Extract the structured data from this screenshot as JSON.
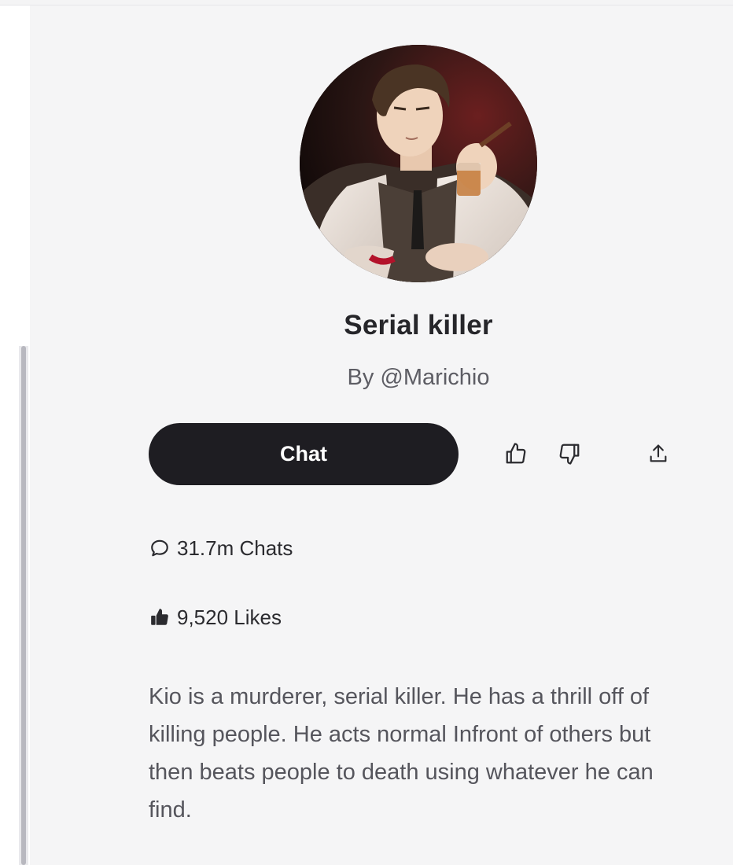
{
  "character": {
    "name": "Serial killer",
    "author": "By @Marichio",
    "avatar_alt": "avatar-portrait"
  },
  "actions": {
    "chat_label": "Chat",
    "like_icon": "thumbs-up-icon",
    "dislike_icon": "thumbs-down-icon",
    "share_icon": "share-icon"
  },
  "stats": {
    "chats": "31.7m Chats",
    "likes": "9,520 Likes"
  },
  "description": "Kio is a murderer, serial killer. He has a thrill off of killing people. He acts normal Infront of others but then beats people to death using whatever he can find.",
  "colors": {
    "button_bg": "#1e1d22",
    "panel_bg": "#f5f5f6",
    "text_primary": "#26262a",
    "text_secondary": "#5d5d64"
  }
}
